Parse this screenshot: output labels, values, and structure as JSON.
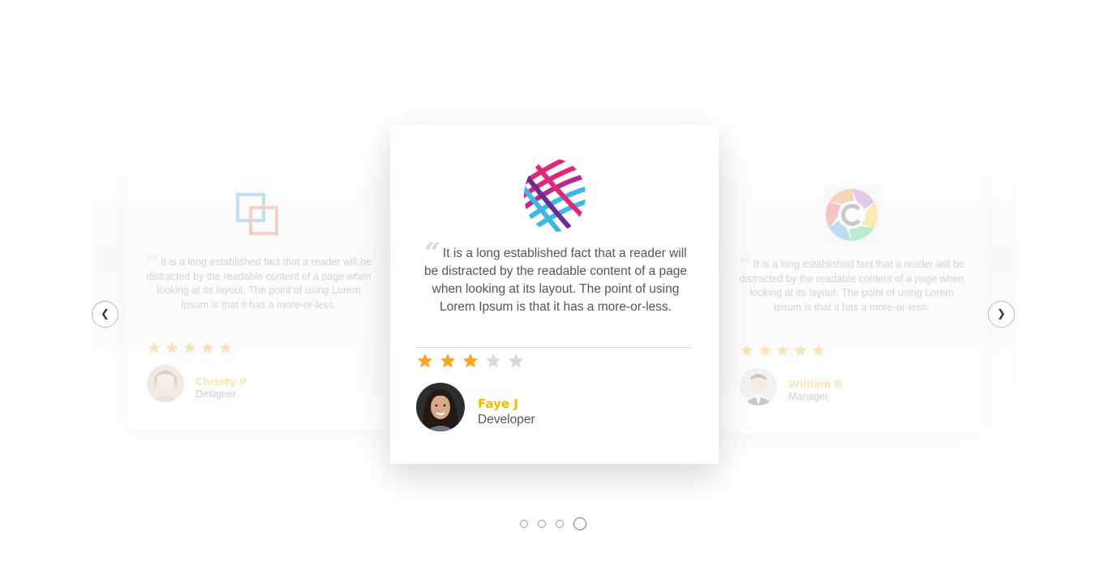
{
  "navigation": {
    "prev_label": "❮",
    "next_label": "❯"
  },
  "pagination": {
    "dot_count": 4,
    "active_index": 3
  },
  "testimonials": [
    {
      "position": "left",
      "quote": "It is a long established fact that a reader will be distracted by the readable content of a page when looking at its layout. The point of using Lorem Ipsum is that it has a more-or-less.",
      "rating": 5,
      "max_rating": 5,
      "name": "Christy P",
      "role": "Designer",
      "logo": "squares-logo"
    },
    {
      "position": "center",
      "quote": "It is a long established fact that a reader will be distracted by the readable content of a page when looking at its layout. The point of using Lorem Ipsum is that it has a more-or-less.",
      "rating": 3,
      "max_rating": 5,
      "name": "Faye J",
      "role": "Developer",
      "logo": "striped-sphere-logo"
    },
    {
      "position": "right",
      "quote": "It is a long established fact that a reader will be distracted by the readable content of a page when looking at its layout. The point of using Lorem Ipsum is that it has a more-or-less.",
      "rating": 5,
      "max_rating": 5,
      "name": "William R",
      "role": "Manager",
      "logo": "aperture-c-logo"
    }
  ],
  "colors": {
    "star_filled": "#f5a623",
    "star_empty": "#d9d9d9",
    "name": "#f5b800",
    "text": "#555555"
  }
}
